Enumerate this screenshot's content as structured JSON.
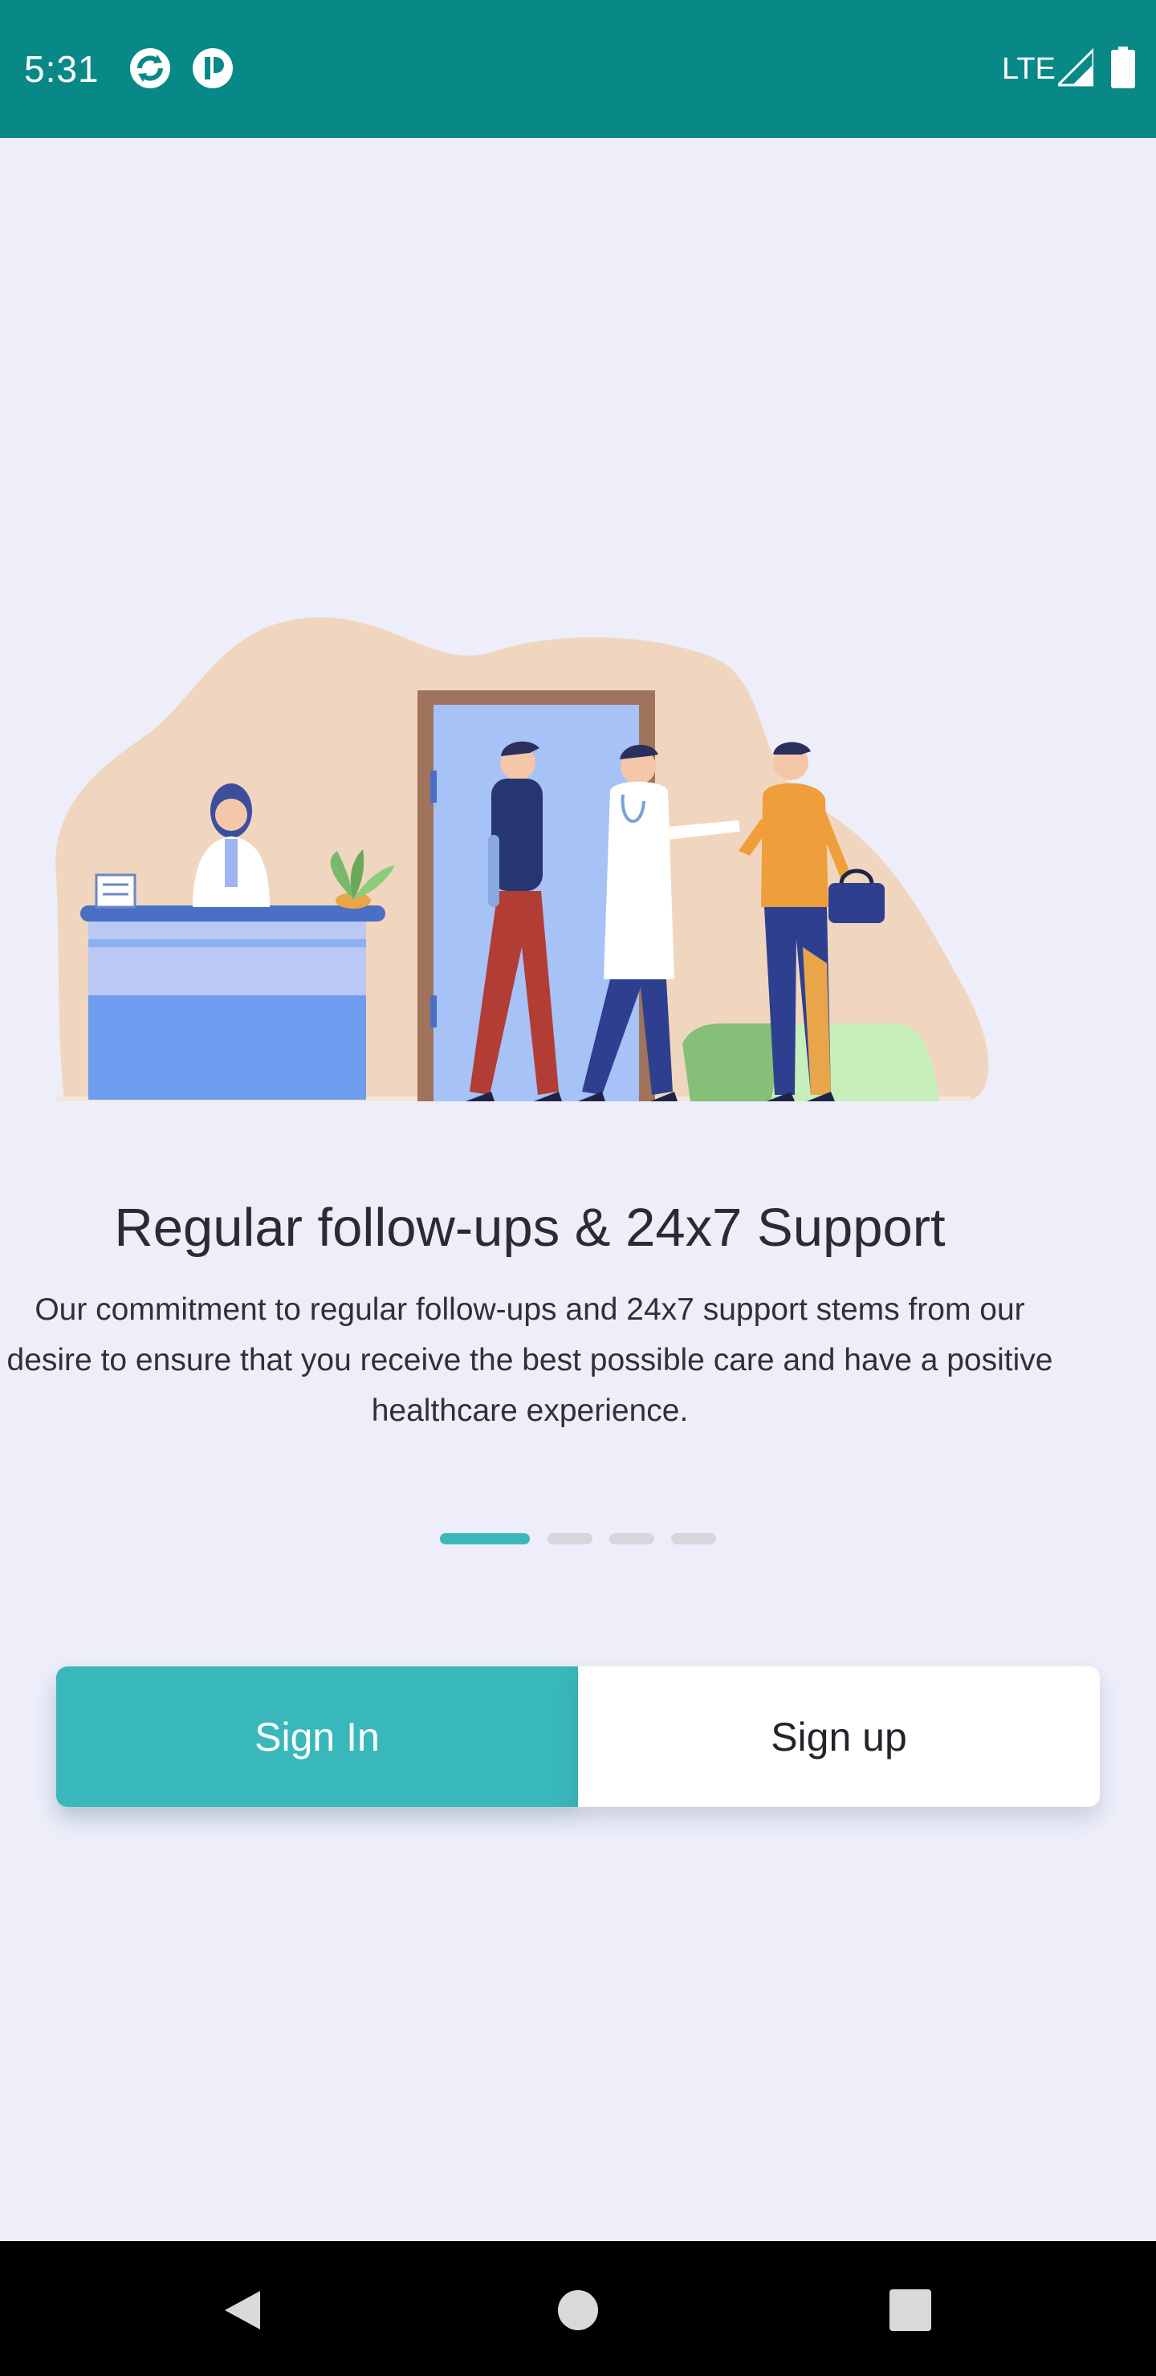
{
  "status_bar": {
    "time": "5:31",
    "network": "LTE",
    "background_color": "#088887",
    "icons": [
      "sync-app-icon",
      "app-notification-icon",
      "signal-icon",
      "battery-icon"
    ]
  },
  "onboarding": {
    "illustration": "clinic-reception-illustration",
    "title": "Regular follow-ups & 24x7 Support",
    "description": "Our commitment to regular follow-ups and 24x7 support stems from our desire to ensure that you receive the best possible care and have a positive healthcare experience.",
    "page_count": 4,
    "active_page": 1
  },
  "auth": {
    "sign_in_label": "Sign In",
    "sign_up_label": "Sign up"
  },
  "colors": {
    "accent": "#39b8bb",
    "background": "#edeefa"
  },
  "nav_bar": {
    "icons": [
      "back-icon",
      "home-icon",
      "recents-icon"
    ]
  }
}
